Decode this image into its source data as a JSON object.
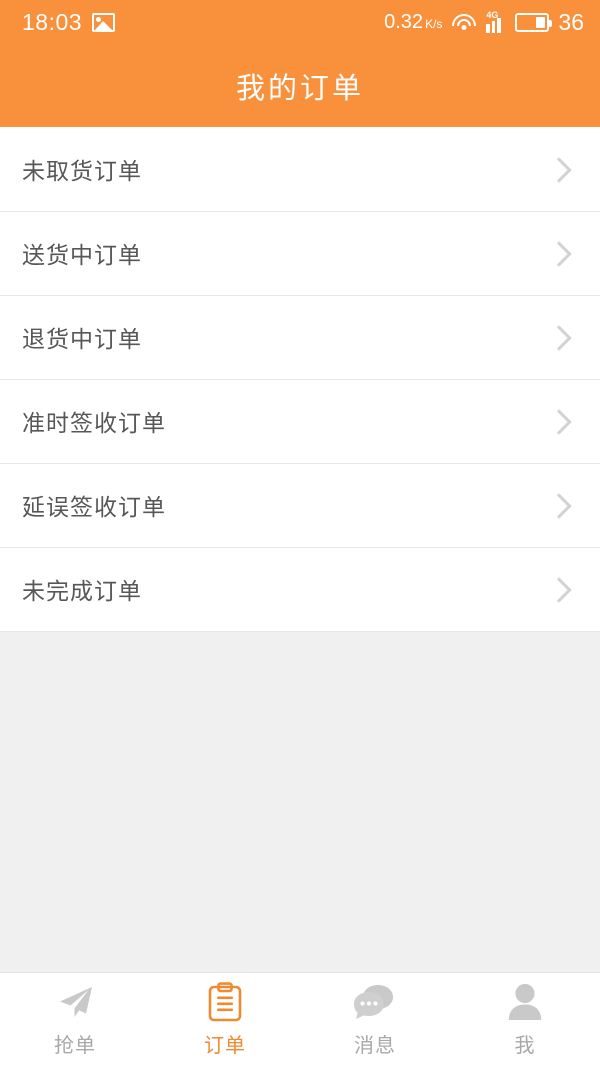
{
  "status_bar": {
    "time": "18:03",
    "photo_icon": "image-icon",
    "net_rate": "0.32",
    "net_rate_unit": "K/s",
    "wifi_icon": "wifi-icon",
    "network_type": "4G",
    "signal_icon": "signal-bars-icon",
    "battery_icon": "battery-icon",
    "battery_level": "36"
  },
  "header": {
    "title": "我的订单"
  },
  "list": {
    "items": [
      {
        "label": "未取货订单",
        "chevron": "chevron-right-icon"
      },
      {
        "label": "送货中订单",
        "chevron": "chevron-right-icon"
      },
      {
        "label": "退货中订单",
        "chevron": "chevron-right-icon"
      },
      {
        "label": "准时签收订单",
        "chevron": "chevron-right-icon"
      },
      {
        "label": "延误签收订单",
        "chevron": "chevron-right-icon"
      },
      {
        "label": "未完成订单",
        "chevron": "chevron-right-icon"
      }
    ]
  },
  "tabbar": {
    "tabs": [
      {
        "label": "抢单",
        "icon": "paper-plane-icon",
        "active": false
      },
      {
        "label": "订单",
        "icon": "clipboard-icon",
        "active": true
      },
      {
        "label": "消息",
        "icon": "chat-bubbles-icon",
        "active": false
      },
      {
        "label": "我",
        "icon": "person-icon",
        "active": false
      }
    ]
  },
  "colors": {
    "accent": "#F8903C",
    "accent_active": "#F08A2E",
    "page_bg": "#F0F0F0",
    "card_bg": "#FFFFFF",
    "text_primary": "#575757",
    "text_muted": "#A8A8A8",
    "divider": "#E6E6E6",
    "chevron": "#D2D2D2"
  }
}
